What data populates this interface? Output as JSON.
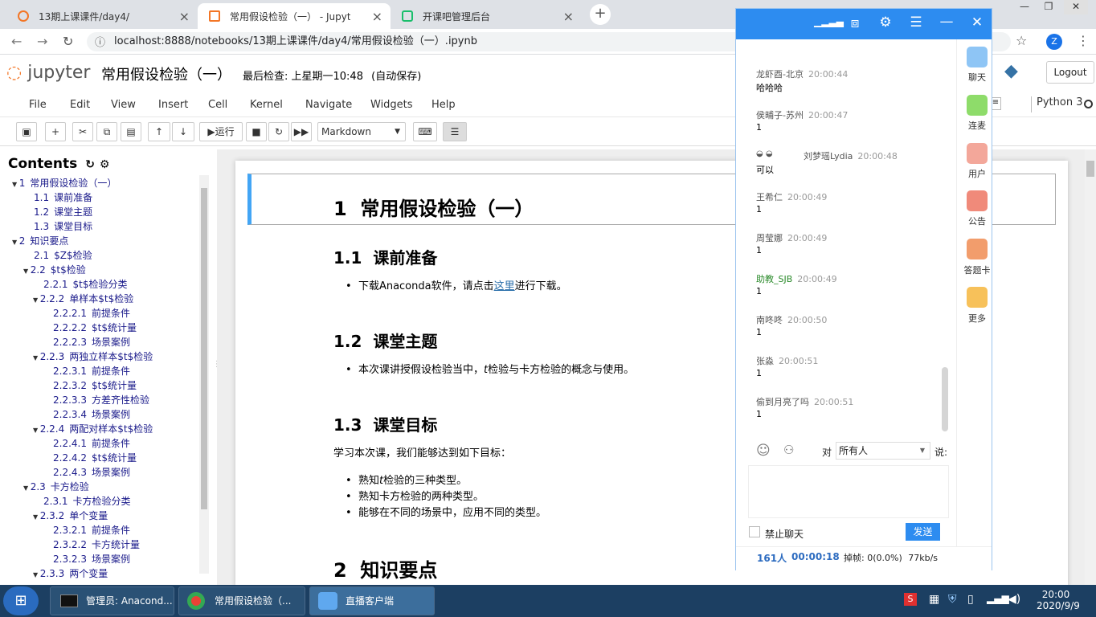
{
  "browser": {
    "tabs": [
      {
        "title": "13期上课课件/day4/"
      },
      {
        "title": "常用假设检验（一） - Jupyter N"
      },
      {
        "title": "开课吧管理后台"
      }
    ],
    "address": "localhost:8888/notebooks/13期上课课件/day4/常用假设检验（一）.ipynb",
    "profile_initial": "Z"
  },
  "jupyter": {
    "logo_text": "jupyter",
    "notebook_title": "常用假设检验（一）",
    "checkpoint": "最后检查: 上星期一10:48",
    "autosave": "(自动保存)",
    "logout": "Logout",
    "kernel": "Python 3",
    "menu": [
      "File",
      "Edit",
      "View",
      "Insert",
      "Cell",
      "Kernel",
      "Navigate",
      "Widgets",
      "Help"
    ],
    "run_label": "运行",
    "cell_type": "Markdown"
  },
  "toc": {
    "title": "Contents",
    "items": [
      {
        "num": "1",
        "label": "常用假设检验（一）",
        "level": 0,
        "arrow": true
      },
      {
        "num": "1.1",
        "label": "课前准备",
        "level": 1
      },
      {
        "num": "1.2",
        "label": "课堂主题",
        "level": 1
      },
      {
        "num": "1.3",
        "label": "课堂目标",
        "level": 1
      },
      {
        "num": "2",
        "label": "知识要点",
        "level": 0,
        "arrow": true
      },
      {
        "num": "2.1",
        "label": "$Z$检验",
        "level": 1
      },
      {
        "num": "2.2",
        "label": "$t$检验",
        "level": 1,
        "arrow": true
      },
      {
        "num": "2.2.1",
        "label": "$t$检验分类",
        "level": 2
      },
      {
        "num": "2.2.2",
        "label": "单样本$t$检验",
        "level": 2,
        "arrow": true
      },
      {
        "num": "2.2.2.1",
        "label": "前提条件",
        "level": 3
      },
      {
        "num": "2.2.2.2",
        "label": "$t$统计量",
        "level": 3
      },
      {
        "num": "2.2.2.3",
        "label": "场景案例",
        "level": 3
      },
      {
        "num": "2.2.3",
        "label": "两独立样本$t$检验",
        "level": 2,
        "arrow": true
      },
      {
        "num": "2.2.3.1",
        "label": "前提条件",
        "level": 3
      },
      {
        "num": "2.2.3.2",
        "label": "$t$统计量",
        "level": 3
      },
      {
        "num": "2.2.3.3",
        "label": "方差齐性检验",
        "level": 3
      },
      {
        "num": "2.2.3.4",
        "label": "场景案例",
        "level": 3
      },
      {
        "num": "2.2.4",
        "label": "两配对样本$t$检验",
        "level": 2,
        "arrow": true
      },
      {
        "num": "2.2.4.1",
        "label": "前提条件",
        "level": 3
      },
      {
        "num": "2.2.4.2",
        "label": "$t$统计量",
        "level": 3
      },
      {
        "num": "2.2.4.3",
        "label": "场景案例",
        "level": 3
      },
      {
        "num": "2.3",
        "label": "卡方检验",
        "level": 1,
        "arrow": true
      },
      {
        "num": "2.3.1",
        "label": "卡方检验分类",
        "level": 2
      },
      {
        "num": "2.3.2",
        "label": "单个变量",
        "level": 2,
        "arrow": true
      },
      {
        "num": "2.3.2.1",
        "label": "前提条件",
        "level": 3
      },
      {
        "num": "2.3.2.2",
        "label": "卡方统计量",
        "level": 3
      },
      {
        "num": "2.3.2.3",
        "label": "场景案例",
        "level": 3
      },
      {
        "num": "2.3.3",
        "label": "两个变量",
        "level": 2,
        "arrow": true
      }
    ]
  },
  "notebook": {
    "h1_num": "1",
    "h1": "常用假设检验（一）",
    "s11_num": "1.1",
    "s11": "课前准备",
    "s11_text_a": "下载Anaconda软件，请点击",
    "s11_link": "这里",
    "s11_text_b": "进行下载。",
    "s12_num": "1.2",
    "s12": "课堂主题",
    "s12_text_a": "本次课讲授假设检验当中，",
    "s12_t": "t",
    "s12_text_b": "检验与卡方检验的概念与使用。",
    "s13_num": "1.3",
    "s13": "课堂目标",
    "s13_intro": "学习本次课，我们能够达到如下目标：",
    "s13_b1a": "熟知",
    "s13_b1t": "t",
    "s13_b1b": "检验的三种类型。",
    "s13_b2": "熟知卡方检验的两种类型。",
    "s13_b3": "能够在不同的场景中，应用不同的类型。",
    "h2_num": "2",
    "h2": "知识要点"
  },
  "chat": {
    "messages": [
      {
        "name": "龙虾酉-北京",
        "time": "20:00:44",
        "text": "哈哈哈"
      },
      {
        "name": "侯晡子-苏州",
        "time": "20:00:47",
        "text": "1"
      },
      {
        "name": "刘梦瑶Lydia",
        "time": "20:00:48",
        "text": "可以"
      },
      {
        "name": "王希仁",
        "time": "20:00:49",
        "text": "1"
      },
      {
        "name": "周莹娜",
        "time": "20:00:49",
        "text": "1"
      },
      {
        "name": "助教_SJB",
        "time": "20:00:49",
        "text": "1"
      },
      {
        "name": "南咚咚",
        "time": "20:00:50",
        "text": "1"
      },
      {
        "name": "张淼",
        "time": "20:00:51",
        "text": "1"
      },
      {
        "name": "偷到月亮了吗",
        "time": "20:00:51",
        "text": "1"
      }
    ],
    "to_label": "对",
    "to_value": "所有人",
    "say_label": "说:",
    "ban_label": "禁止聊天",
    "send_label": "发送",
    "count": "161人",
    "duration": "00:00:18",
    "drop_label": "掉帧:",
    "drop_value": "0(0.0%)",
    "bitrate": "77kb/s",
    "side": [
      "聊天",
      "连麦",
      "用户",
      "公告",
      "答题卡",
      "更多"
    ]
  },
  "taskbar": {
    "tasks": [
      "管理员: Anacond...",
      "常用假设检验（...",
      "直播客户端"
    ],
    "time": "20:00",
    "date": "2020/9/9"
  },
  "colors": {
    "accent": "#2d8cf0",
    "selected_cell": "#42a5f5",
    "taskbar": "#1c3f62"
  }
}
